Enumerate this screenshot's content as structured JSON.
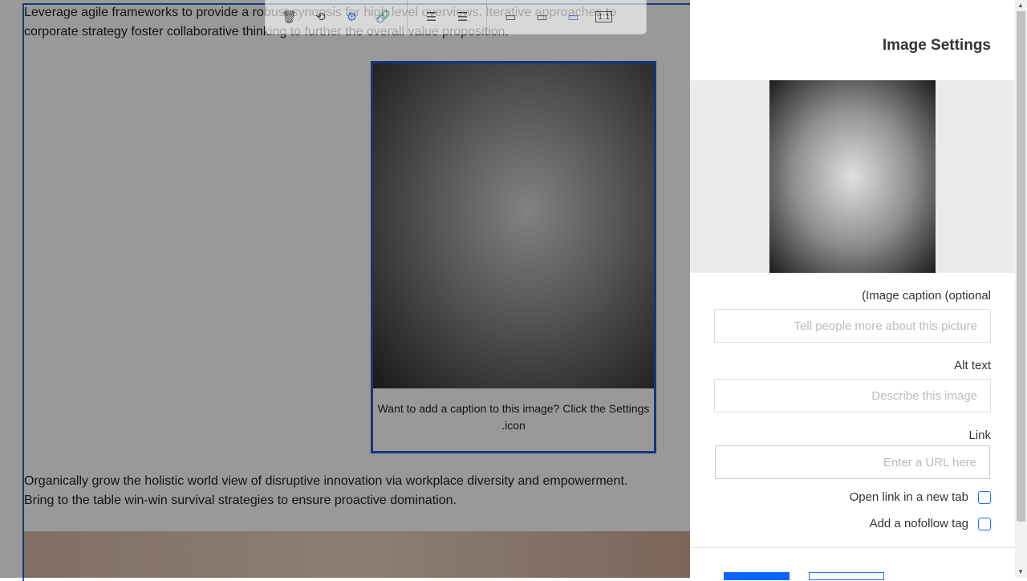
{
  "editor": {
    "para1": "Leverage agile frameworks to provide a robust synopsis for high level overviews. Iterative approaches to corporate strategy foster collaborative thinking to further the overall value proposition.",
    "caption": "Want to add a caption to this image? Click the Settings .icon",
    "para2": "Organically grow the holistic world view of disruptive innovation via workplace diversity and empowerment. Bring to the table win-win survival strategies to ensure proactive domination."
  },
  "toolbar": {
    "icons": [
      "trash-icon",
      "replace-icon",
      "settings-icon",
      "link-icon",
      "align-left-icon",
      "align-right-icon",
      "full-width-icon",
      "wide-icon",
      "fit-icon",
      "original-size-icon"
    ],
    "original_label": "1:1",
    "active_color": "#1e5bd6"
  },
  "panel": {
    "title": "Image Settings",
    "caption_label": "(Image caption (optional",
    "caption_placeholder": "Tell people more about this picture",
    "alt_label": "Alt text",
    "alt_placeholder": "Describe this image",
    "link_label": "Link",
    "link_placeholder": "Enter a URL here",
    "new_tab_label": "Open link in a new tab",
    "nofollow_label": "Add a nofollow tag",
    "accent": "#0a64ff"
  }
}
